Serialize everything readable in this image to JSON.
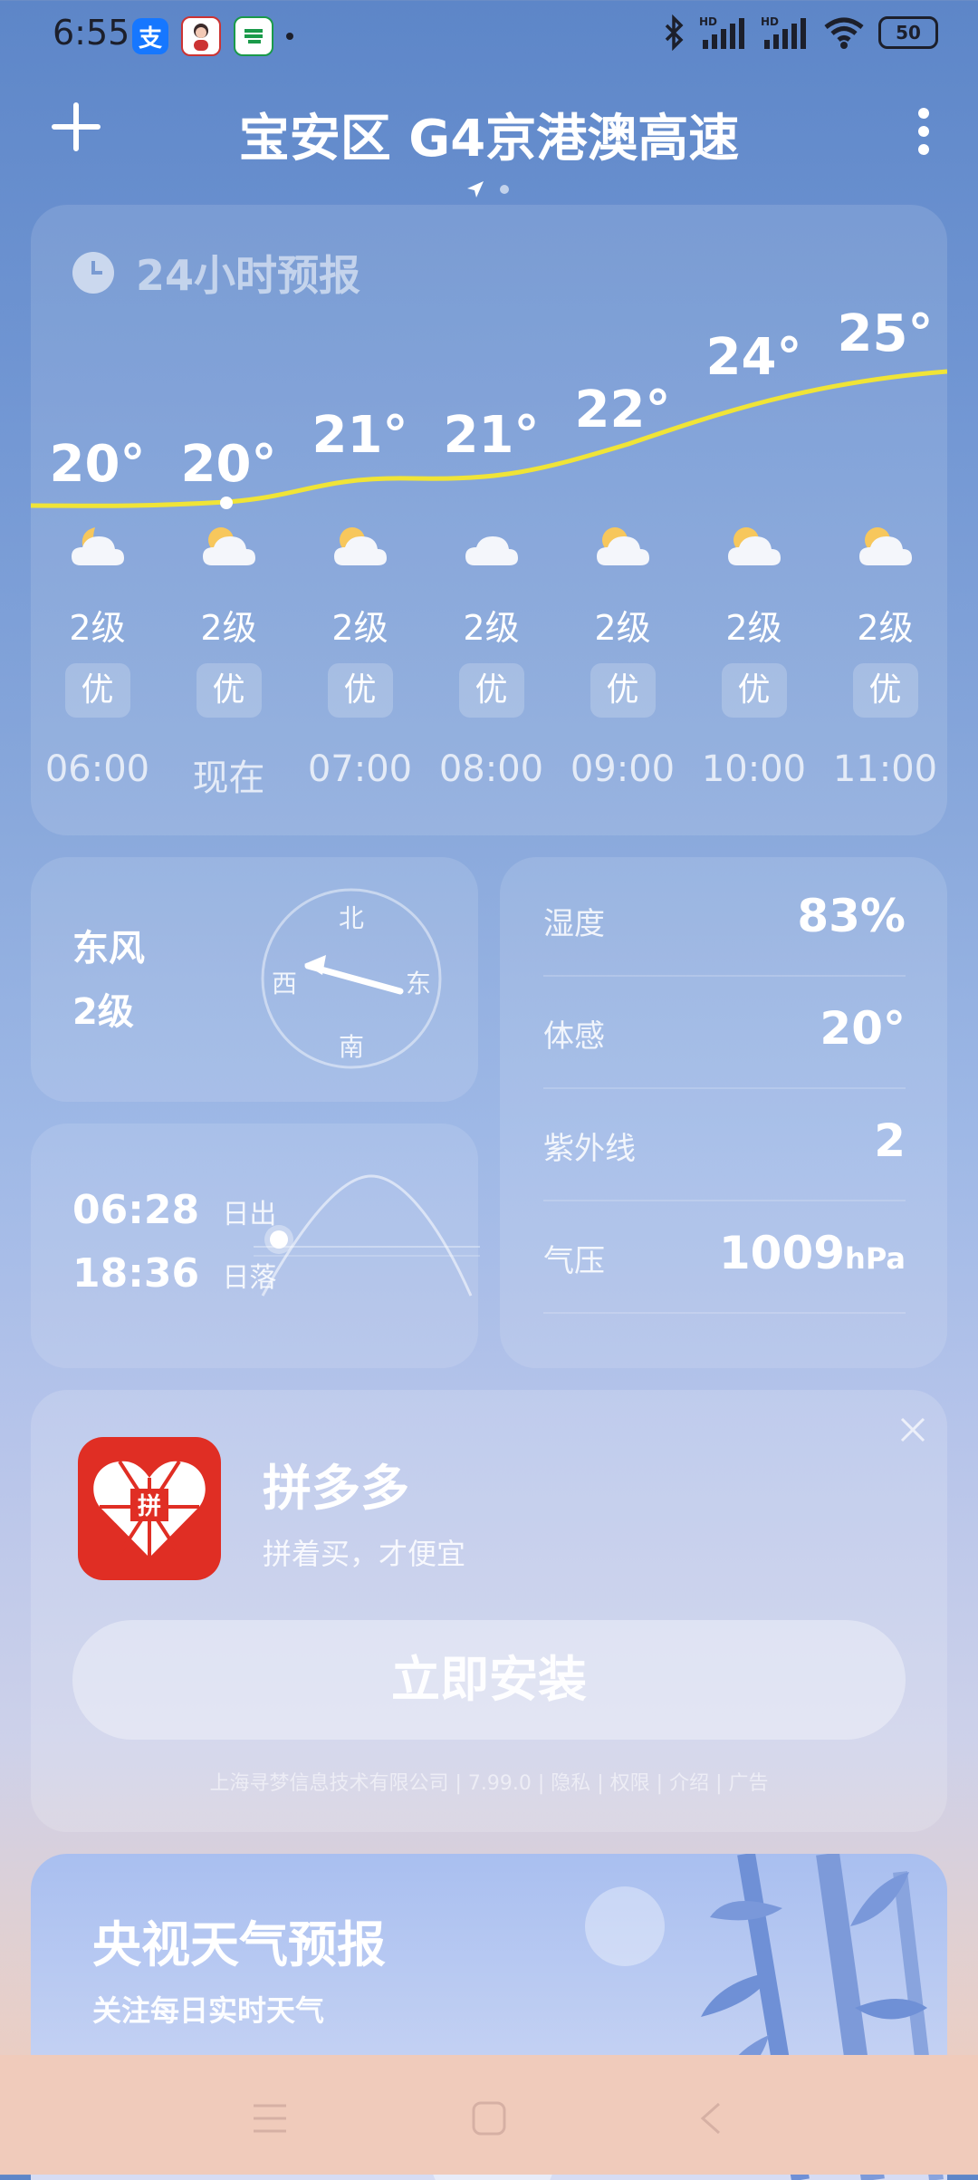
{
  "status": {
    "time": "6:55",
    "battery": "50"
  },
  "header": {
    "title": "宝安区 G4京港澳高速"
  },
  "forecast": {
    "title": "24小时预报",
    "hours": [
      {
        "temp": "20°",
        "wind": "2级",
        "aqi": "优",
        "time": "06:00",
        "icon": "moon-cloud-icon"
      },
      {
        "temp": "20°",
        "wind": "2级",
        "aqi": "优",
        "time": "现在",
        "icon": "sun-cloud-icon"
      },
      {
        "temp": "21°",
        "wind": "2级",
        "aqi": "优",
        "time": "07:00",
        "icon": "sun-cloud-icon"
      },
      {
        "temp": "21°",
        "wind": "2级",
        "aqi": "优",
        "time": "08:00",
        "icon": "cloud-icon"
      },
      {
        "temp": "22°",
        "wind": "2级",
        "aqi": "优",
        "time": "09:00",
        "icon": "sun-cloud-icon"
      },
      {
        "temp": "24°",
        "wind": "2级",
        "aqi": "优",
        "time": "10:00",
        "icon": "sun-cloud-icon"
      },
      {
        "temp": "25°",
        "wind": "2级",
        "aqi": "优",
        "time": "11:00",
        "icon": "sun-cloud-icon"
      }
    ]
  },
  "wind": {
    "direction": "东风",
    "level": "2级",
    "compass": {
      "n": "北",
      "s": "南",
      "w": "西",
      "e": "东"
    }
  },
  "sun": {
    "sunrise": "06:28",
    "sunrise_label": "日出",
    "sunset": "18:36",
    "sunset_label": "日落"
  },
  "details": [
    {
      "label": "湿度",
      "value": "83%",
      "unit": ""
    },
    {
      "label": "体感",
      "value": "20°",
      "unit": ""
    },
    {
      "label": "紫外线",
      "value": "2",
      "unit": ""
    },
    {
      "label": "气压",
      "value": "1009",
      "unit": "hPa"
    }
  ],
  "ad": {
    "app_name": "拼多多",
    "slogan": "拼着买，才便宜",
    "install": "立即安装",
    "logo_char": "拼",
    "footer": "上海寻梦信息技术有限公司 | 7.99.0 | 隐私 | 权限 | 介绍 | 广告"
  },
  "cctv": {
    "title": "央视天气预报",
    "subtitle": "关注每日实时天气"
  },
  "colors": {
    "curve": "#f0e437",
    "pdd_red": "#e02e24"
  }
}
